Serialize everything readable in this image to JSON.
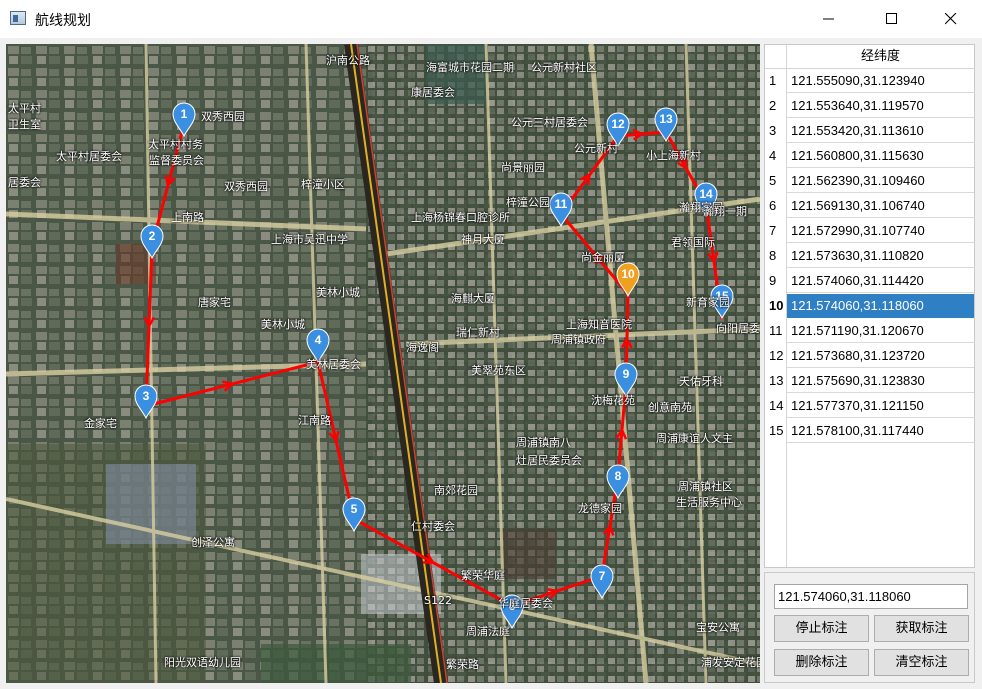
{
  "window": {
    "title": "航线规划"
  },
  "table": {
    "header": "经纬度",
    "rows": [
      {
        "num": "1",
        "value": "121.555090,31.123940"
      },
      {
        "num": "2",
        "value": "121.553640,31.119570"
      },
      {
        "num": "3",
        "value": "121.553420,31.113610"
      },
      {
        "num": "4",
        "value": "121.560800,31.115630"
      },
      {
        "num": "5",
        "value": "121.562390,31.109460"
      },
      {
        "num": "6",
        "value": "121.569130,31.106740"
      },
      {
        "num": "7",
        "value": "121.572990,31.107740"
      },
      {
        "num": "8",
        "value": "121.573630,31.110820"
      },
      {
        "num": "9",
        "value": "121.574060,31.114420"
      },
      {
        "num": "10",
        "value": "121.574060,31.118060"
      },
      {
        "num": "11",
        "value": "121.571190,31.120670"
      },
      {
        "num": "12",
        "value": "121.573680,31.123720"
      },
      {
        "num": "13",
        "value": "121.575690,31.123830"
      },
      {
        "num": "14",
        "value": "121.577370,31.121150"
      },
      {
        "num": "15",
        "value": "121.578100,31.117440"
      }
    ],
    "selected_index": 9
  },
  "controls": {
    "coord_value": "121.574060,31.118060",
    "stop_label": "停止标注",
    "get_label": "获取标注",
    "delete_label": "删除标注",
    "clear_label": "清空标注"
  },
  "map": {
    "route_color": "#ff0000",
    "marker_color": "#3b8fe0",
    "selected_marker_color": "#f0a020",
    "markers": [
      {
        "label": "1"
      },
      {
        "label": "2"
      },
      {
        "label": "3"
      },
      {
        "label": "4"
      },
      {
        "label": "5"
      },
      {
        "label": "6"
      },
      {
        "label": "7"
      },
      {
        "label": "8"
      },
      {
        "label": "9"
      },
      {
        "label": "10"
      },
      {
        "label": "11"
      },
      {
        "label": "12"
      },
      {
        "label": "13"
      },
      {
        "label": "14"
      },
      {
        "label": "15"
      }
    ],
    "labels": [
      "双秀西园",
      "太平村村务",
      "监督委员会",
      "太平村居委会",
      "太平村",
      "卫生室",
      "居委会",
      "双秀西园",
      "梓潼小区",
      "上南路",
      "上海市吴迅中学",
      "唐家宅",
      "美林小城",
      "美林小城",
      "美林居委会",
      "金家宅",
      "江南路",
      "仁村委会",
      "创泽公寓",
      "阳光双语幼儿园",
      "周浦法庭",
      "繁荣华庭",
      "华庭居委会",
      "繁荣路",
      "海富城市花园二期",
      "公元新村社区",
      "康居委会",
      "公元三村居委会",
      "公元新村",
      "尚景丽园",
      "梓潼公园",
      "上海杨锦春口腔诊所",
      "神月大厦",
      "海麒大厦",
      "海逸阁",
      "瑞仁新村",
      "美翠苑东区",
      "周浦镇政府",
      "上海知音医院",
      "周浦镇南八",
      "灶居民委员会",
      "南郊花园",
      "龙德家园",
      "尚金丽厦",
      "沈梅花苑",
      "创意南苑",
      "周浦康谊人文主",
      "周浦镇社区",
      "生活服务中心",
      "君领国际",
      "新育家园",
      "向阳居委",
      "天佑牙科",
      "小上海新村",
      "瀚翔家园",
      "瀚翔一期",
      "宝安公寓",
      "浦发安定花园",
      "沪南公路",
      "S122"
    ]
  },
  "icons": {
    "app": "app-window-icon",
    "minimize": "minimize-icon",
    "maximize": "maximize-icon",
    "close": "close-icon"
  }
}
